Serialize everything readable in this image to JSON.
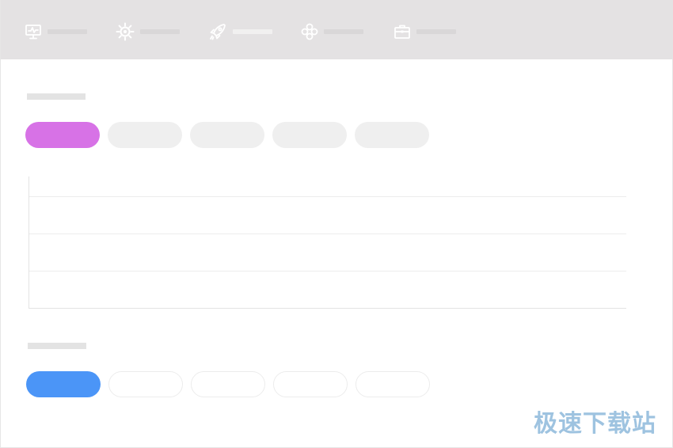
{
  "nav": {
    "items": [
      {
        "icon": "monitor-icon",
        "active": false
      },
      {
        "icon": "gear-icon",
        "active": false
      },
      {
        "icon": "rocket-icon",
        "active": true
      },
      {
        "icon": "clover-icon",
        "active": false
      },
      {
        "icon": "briefcase-icon",
        "active": false
      }
    ]
  },
  "colors": {
    "nav_background": "#e4e2e3",
    "icon": "#ffffff",
    "pill_active_primary": "#d772e6",
    "pill_active_secondary": "#4b95f7",
    "pill_inactive": "#efefef",
    "watermark": "#9ec3e0"
  },
  "section1": {
    "tabs": [
      {
        "active": true
      },
      {
        "active": false
      },
      {
        "active": false
      },
      {
        "active": false
      },
      {
        "active": false
      }
    ],
    "list_rows": 4
  },
  "section2": {
    "tabs": [
      {
        "active": true
      },
      {
        "active": false
      },
      {
        "active": false
      },
      {
        "active": false
      },
      {
        "active": false
      }
    ]
  },
  "watermark": {
    "text": "极速下载站"
  }
}
